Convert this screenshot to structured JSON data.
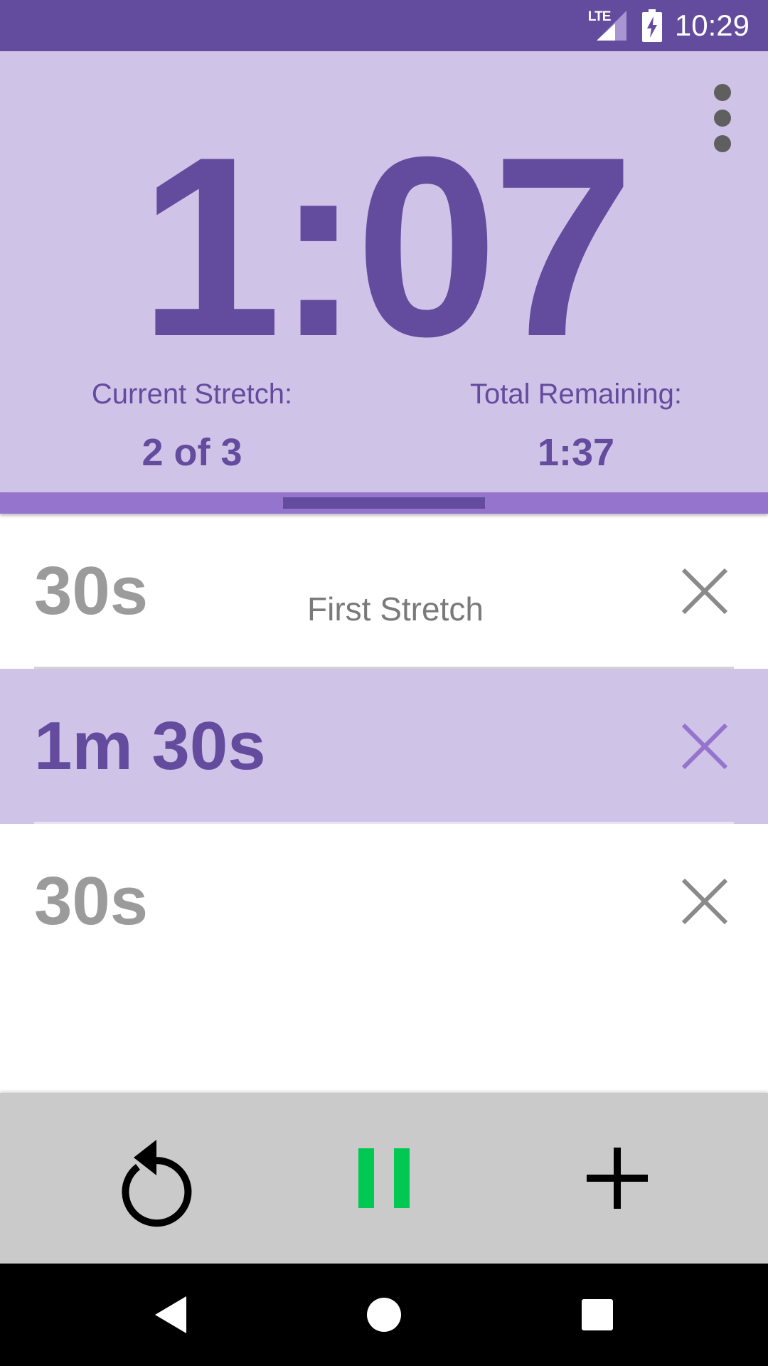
{
  "status_bar": {
    "network": "LTE",
    "time": "10:29"
  },
  "timer": {
    "display": "1:07",
    "current_stretch_label": "Current Stretch:",
    "current_stretch_value": "2 of 3",
    "total_remaining_label": "Total Remaining:",
    "total_remaining_value": "1:37"
  },
  "stretches": [
    {
      "duration": "30s",
      "name": "First Stretch",
      "active": false
    },
    {
      "duration": "1m 30s",
      "name": "",
      "active": true
    },
    {
      "duration": "30s",
      "name": "",
      "active": false
    }
  ],
  "icons": {
    "menu": "more-vert-icon",
    "delete": "close-icon",
    "restart": "restart-icon",
    "pause": "pause-icon",
    "add": "plus-icon",
    "nav_back": "back-icon",
    "nav_home": "home-icon",
    "nav_recents": "recents-icon"
  },
  "colors": {
    "primary": "#634b9e",
    "header_bg": "#d0c3e8",
    "accent": "#9574ce",
    "pause": "#00c853",
    "controls_bg": "#cacaca"
  }
}
